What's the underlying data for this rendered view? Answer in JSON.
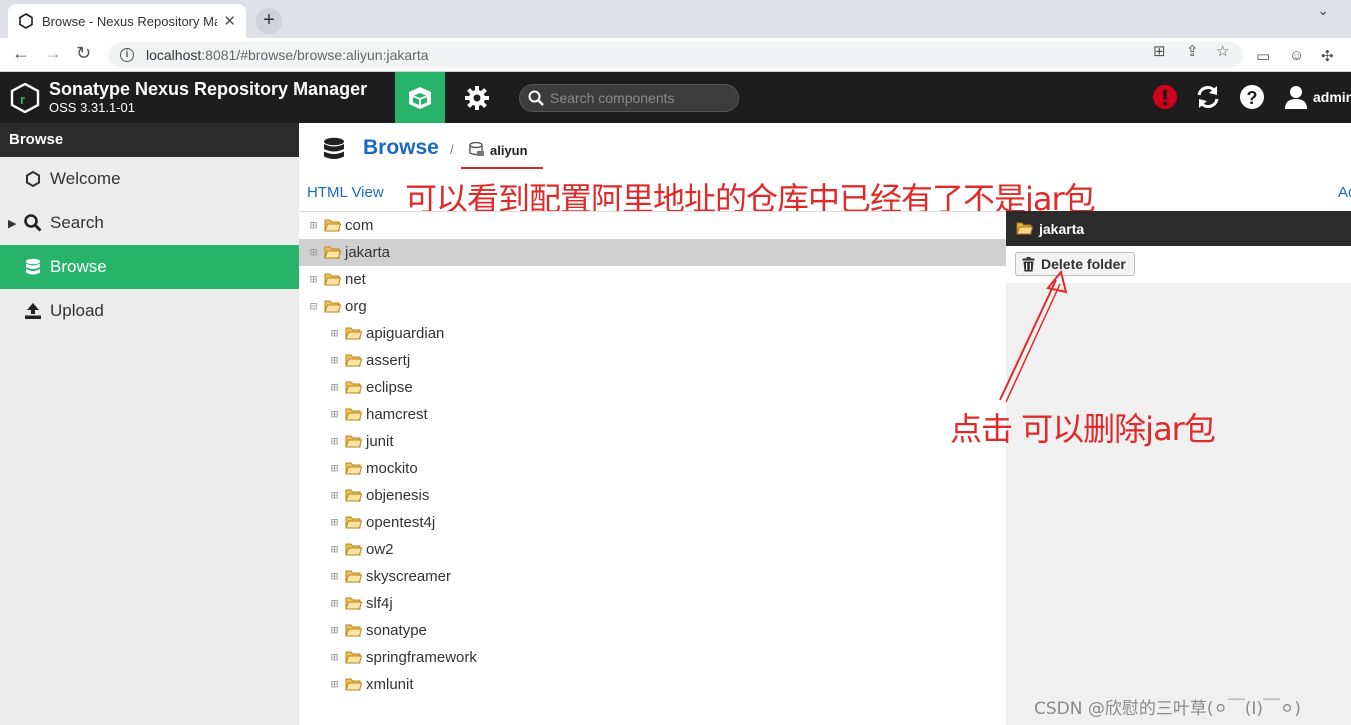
{
  "browser": {
    "tab_title": "Browse - Nexus Repository Ma",
    "tab_close": "✕",
    "new_tab": "+",
    "url_host": "localhost",
    "url_rest": ":8081/#browse/browse:aliyun:jakarta"
  },
  "header": {
    "product_title": "Sonatype Nexus Repository Manager",
    "product_version": "OSS 3.31.1-01",
    "search_placeholder": "Search components",
    "user_name": "admin",
    "colors": {
      "accent": "#27b36a",
      "header_bg": "#1d1d1d",
      "alert": "#d0021b"
    }
  },
  "sidebar": {
    "title": "Browse",
    "items": [
      {
        "label": "Welcome",
        "icon": "hexagon-icon",
        "active": false
      },
      {
        "label": "Search",
        "icon": "search-icon",
        "active": false,
        "caret": "▶"
      },
      {
        "label": "Browse",
        "icon": "database-icon",
        "active": true
      },
      {
        "label": "Upload",
        "icon": "upload-icon",
        "active": false
      }
    ]
  },
  "breadcrumb": {
    "root": "Browse",
    "separator": "/",
    "repository": "aliyun"
  },
  "main": {
    "html_view_link": "HTML View",
    "right_edge_text": "Ac",
    "annotation_top": "可以看到配置阿里地址的仓库中已经有了不是jar包",
    "annotation_click": "点击 可以删除jar包",
    "tree_top": [
      {
        "label": "com",
        "selected": false
      },
      {
        "label": "jakarta",
        "selected": true
      },
      {
        "label": "net",
        "selected": false
      },
      {
        "label": "org",
        "selected": false,
        "expanded": true
      }
    ],
    "tree_org_children": [
      "apiguardian",
      "assertj",
      "eclipse",
      "hamcrest",
      "junit",
      "mockito",
      "objenesis",
      "opentest4j",
      "ow2",
      "skyscreamer",
      "slf4j",
      "sonatype",
      "springframework",
      "xmlunit"
    ]
  },
  "detail_panel": {
    "title": "jakarta",
    "delete_button": "Delete folder"
  },
  "watermark": "CSDN @欣慰的三叶草(⚪￣(I)￣⚪)"
}
